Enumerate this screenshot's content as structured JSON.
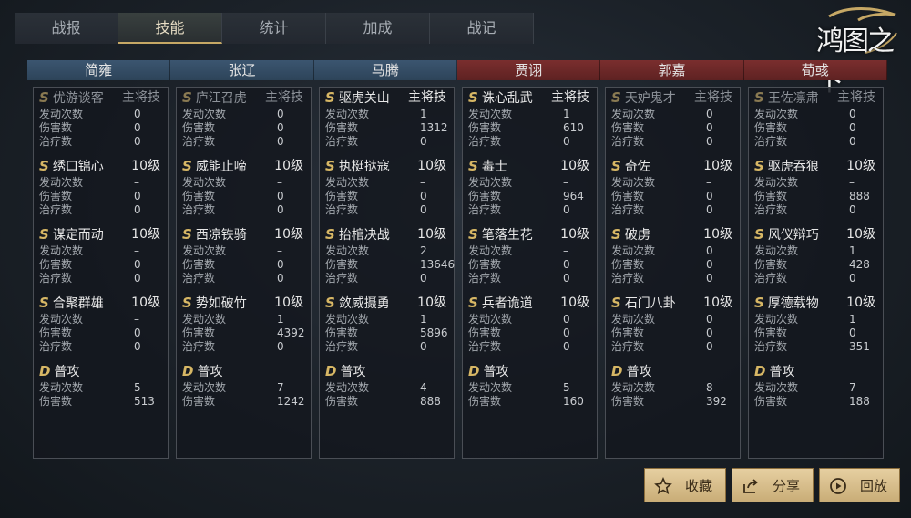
{
  "tabs": [
    "战报",
    "技能",
    "统计",
    "加成",
    "战记"
  ],
  "active_tab": 1,
  "logo_text": "鸿图之下",
  "generals": [
    {
      "name": "简雍",
      "side": "blue",
      "skills": [
        {
          "grade": "S",
          "name": "优游谈客",
          "level": "主将技",
          "dim": true,
          "stats": [
            [
              "发动次数",
              "0"
            ],
            [
              "伤害数",
              "0"
            ],
            [
              "治疗数",
              "0"
            ]
          ]
        },
        {
          "grade": "S",
          "name": "绣口锦心",
          "level": "10级",
          "dim": false,
          "stats": [
            [
              "发动次数",
              "–"
            ],
            [
              "伤害数",
              "0"
            ],
            [
              "治疗数",
              "0"
            ]
          ]
        },
        {
          "grade": "S",
          "name": "谋定而动",
          "level": "10级",
          "dim": false,
          "stats": [
            [
              "发动次数",
              "–"
            ],
            [
              "伤害数",
              "0"
            ],
            [
              "治疗数",
              "0"
            ]
          ]
        },
        {
          "grade": "S",
          "name": "合聚群雄",
          "level": "10级",
          "dim": false,
          "stats": [
            [
              "发动次数",
              "–"
            ],
            [
              "伤害数",
              "0"
            ],
            [
              "治疗数",
              "0"
            ]
          ]
        },
        {
          "grade": "D",
          "name": "普攻",
          "level": "",
          "dim": false,
          "stats": [
            [
              "发动次数",
              "5"
            ],
            [
              "伤害数",
              "513"
            ]
          ]
        }
      ]
    },
    {
      "name": "张辽",
      "side": "blue",
      "skills": [
        {
          "grade": "S",
          "name": "庐江召虎",
          "level": "主将技",
          "dim": true,
          "stats": [
            [
              "发动次数",
              "0"
            ],
            [
              "伤害数",
              "0"
            ],
            [
              "治疗数",
              "0"
            ]
          ]
        },
        {
          "grade": "S",
          "name": "威能止啼",
          "level": "10级",
          "dim": false,
          "stats": [
            [
              "发动次数",
              "–"
            ],
            [
              "伤害数",
              "0"
            ],
            [
              "治疗数",
              "0"
            ]
          ]
        },
        {
          "grade": "S",
          "name": "西凉铁骑",
          "level": "10级",
          "dim": false,
          "stats": [
            [
              "发动次数",
              "–"
            ],
            [
              "伤害数",
              "0"
            ],
            [
              "治疗数",
              "0"
            ]
          ]
        },
        {
          "grade": "S",
          "name": "势如破竹",
          "level": "10级",
          "dim": false,
          "stats": [
            [
              "发动次数",
              "1"
            ],
            [
              "伤害数",
              "4392"
            ],
            [
              "治疗数",
              "0"
            ]
          ]
        },
        {
          "grade": "D",
          "name": "普攻",
          "level": "",
          "dim": false,
          "stats": [
            [
              "发动次数",
              "7"
            ],
            [
              "伤害数",
              "1242"
            ]
          ]
        }
      ]
    },
    {
      "name": "马腾",
      "side": "blue",
      "skills": [
        {
          "grade": "S",
          "name": "驱虎关山",
          "level": "主将技",
          "dim": false,
          "stats": [
            [
              "发动次数",
              "1"
            ],
            [
              "伤害数",
              "1312"
            ],
            [
              "治疗数",
              "0"
            ]
          ]
        },
        {
          "grade": "S",
          "name": "执梃挞寇",
          "level": "10级",
          "dim": false,
          "stats": [
            [
              "发动次数",
              "–"
            ],
            [
              "伤害数",
              "0"
            ],
            [
              "治疗数",
              "0"
            ]
          ]
        },
        {
          "grade": "S",
          "name": "抬棺决战",
          "level": "10级",
          "dim": false,
          "stats": [
            [
              "发动次数",
              "2"
            ],
            [
              "伤害数",
              "13646"
            ],
            [
              "治疗数",
              "0"
            ]
          ]
        },
        {
          "grade": "S",
          "name": "敛威摄勇",
          "level": "10级",
          "dim": false,
          "stats": [
            [
              "发动次数",
              "1"
            ],
            [
              "伤害数",
              "5896"
            ],
            [
              "治疗数",
              "0"
            ]
          ]
        },
        {
          "grade": "D",
          "name": "普攻",
          "level": "",
          "dim": false,
          "stats": [
            [
              "发动次数",
              "4"
            ],
            [
              "伤害数",
              "888"
            ]
          ]
        }
      ]
    },
    {
      "name": "贾诩",
      "side": "red",
      "skills": [
        {
          "grade": "S",
          "name": "诛心乱武",
          "level": "主将技",
          "dim": false,
          "stats": [
            [
              "发动次数",
              "1"
            ],
            [
              "伤害数",
              "610"
            ],
            [
              "治疗数",
              "0"
            ]
          ]
        },
        {
          "grade": "S",
          "name": "毒士",
          "level": "10级",
          "dim": false,
          "stats": [
            [
              "发动次数",
              "–"
            ],
            [
              "伤害数",
              "964"
            ],
            [
              "治疗数",
              "0"
            ]
          ]
        },
        {
          "grade": "S",
          "name": "笔落生花",
          "level": "10级",
          "dim": false,
          "stats": [
            [
              "发动次数",
              "–"
            ],
            [
              "伤害数",
              "0"
            ],
            [
              "治疗数",
              "0"
            ]
          ]
        },
        {
          "grade": "S",
          "name": "兵者诡道",
          "level": "10级",
          "dim": false,
          "stats": [
            [
              "发动次数",
              "0"
            ],
            [
              "伤害数",
              "0"
            ],
            [
              "治疗数",
              "0"
            ]
          ]
        },
        {
          "grade": "D",
          "name": "普攻",
          "level": "",
          "dim": false,
          "stats": [
            [
              "发动次数",
              "5"
            ],
            [
              "伤害数",
              "160"
            ]
          ]
        }
      ]
    },
    {
      "name": "郭嘉",
      "side": "red",
      "skills": [
        {
          "grade": "S",
          "name": "天妒鬼才",
          "level": "主将技",
          "dim": true,
          "stats": [
            [
              "发动次数",
              "0"
            ],
            [
              "伤害数",
              "0"
            ],
            [
              "治疗数",
              "0"
            ]
          ]
        },
        {
          "grade": "S",
          "name": "奇佐",
          "level": "10级",
          "dim": false,
          "stats": [
            [
              "发动次数",
              "–"
            ],
            [
              "伤害数",
              "0"
            ],
            [
              "治疗数",
              "0"
            ]
          ]
        },
        {
          "grade": "S",
          "name": "破虏",
          "level": "10级",
          "dim": false,
          "stats": [
            [
              "发动次数",
              "0"
            ],
            [
              "伤害数",
              "0"
            ],
            [
              "治疗数",
              "0"
            ]
          ]
        },
        {
          "grade": "S",
          "name": "石门八卦",
          "level": "10级",
          "dim": false,
          "stats": [
            [
              "发动次数",
              "0"
            ],
            [
              "伤害数",
              "0"
            ],
            [
              "治疗数",
              "0"
            ]
          ]
        },
        {
          "grade": "D",
          "name": "普攻",
          "level": "",
          "dim": false,
          "stats": [
            [
              "发动次数",
              "8"
            ],
            [
              "伤害数",
              "392"
            ]
          ]
        }
      ]
    },
    {
      "name": "荀彧",
      "side": "red",
      "skills": [
        {
          "grade": "S",
          "name": "王佐凛肃",
          "level": "主将技",
          "dim": true,
          "stats": [
            [
              "发动次数",
              "0"
            ],
            [
              "伤害数",
              "0"
            ],
            [
              "治疗数",
              "0"
            ]
          ]
        },
        {
          "grade": "S",
          "name": "驱虎吞狼",
          "level": "10级",
          "dim": false,
          "stats": [
            [
              "发动次数",
              "–"
            ],
            [
              "伤害数",
              "888"
            ],
            [
              "治疗数",
              "0"
            ]
          ]
        },
        {
          "grade": "S",
          "name": "风仪辩巧",
          "level": "10级",
          "dim": false,
          "stats": [
            [
              "发动次数",
              "1"
            ],
            [
              "伤害数",
              "428"
            ],
            [
              "治疗数",
              "0"
            ]
          ]
        },
        {
          "grade": "S",
          "name": "厚德载物",
          "level": "10级",
          "dim": false,
          "stats": [
            [
              "发动次数",
              "1"
            ],
            [
              "伤害数",
              "0"
            ],
            [
              "治疗数",
              "351"
            ]
          ]
        },
        {
          "grade": "D",
          "name": "普攻",
          "level": "",
          "dim": false,
          "stats": [
            [
              "发动次数",
              "7"
            ],
            [
              "伤害数",
              "188"
            ]
          ]
        }
      ]
    }
  ],
  "buttons": {
    "collect": "收藏",
    "share": "分享",
    "replay": "回放"
  },
  "icons": {
    "collect": "star-icon",
    "share": "share-icon",
    "replay": "play-icon"
  },
  "colors": {
    "accent": "#c6a865",
    "blue_team": "#3b5570",
    "red_team": "#7a2e2e",
    "button": "#d8bf8c"
  }
}
